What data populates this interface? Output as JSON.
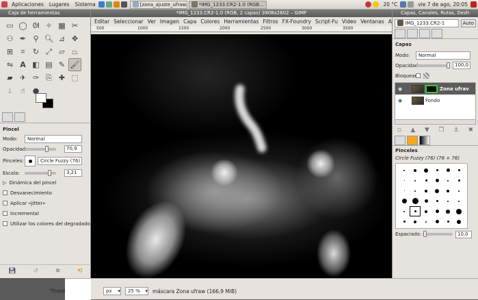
{
  "top_panel": {
    "menus": [
      "Aplicaciones",
      "Lugares",
      "Sistema"
    ],
    "tasks": [
      {
        "label": "",
        "icon": "desktop-icon"
      },
      {
        "label": "[zona_ajuste_ufraw.sc...",
        "icon": "image-icon"
      },
      {
        "label": "*IMG_1233.CR2-1.0 (RGB...",
        "icon": "gimp-icon"
      }
    ],
    "weather": "20 °C",
    "clock": "vie  7 de ago, 20:05"
  },
  "toolbox": {
    "title": "Caja de herramientas",
    "tool_options_title": "Pincel",
    "mode_label": "Modo:",
    "mode_value": "Normal",
    "opacity_label": "Opacidad:",
    "opacity_value": "70,9",
    "opacity_level": 0.709,
    "brush_label": "Pinceles:",
    "brush_value": "Circle Fuzzy (76)",
    "scale_label": "Escala:",
    "scale_value": "3,21",
    "scale_level": 0.8,
    "dynamics_label": "Dinámica del pincel",
    "checks": [
      "Desvanecimiento",
      "Aplicar «jitter»",
      "Incremental",
      "Utilizar los colores del degradado"
    ]
  },
  "image_window": {
    "title": "*IMG_1233.CR2-1.0 (RGB, 2 capas) 3908x2602 – GIMP",
    "menus": [
      "Editar",
      "Seleccionar",
      "Ver",
      "Imagen",
      "Capa",
      "Colores",
      "Herramientas",
      "Filtros",
      "FX-Foundry",
      "Script-Fu",
      "Video",
      "Ventanas",
      "Ayuda"
    ],
    "ruler_ticks": [
      "500",
      "1000",
      "1500",
      "2000",
      "2500",
      "3000",
      "3500"
    ],
    "unit": "px",
    "zoom": "25 %",
    "status_text": "máscara Zona ufraw (166,9 MiB)",
    "behind_label": "Thund"
  },
  "dock": {
    "title": "Capas, Canales, Rutas, Desh",
    "image_select": "IMG_1233.CR2-1",
    "auto_label": "Auto",
    "layers_header": "Capas",
    "mode_label": "Modo:",
    "mode_value": "Normal",
    "opacity_label": "Opacidad:",
    "opacity_value": "100,0",
    "lock_label": "Bloquear:",
    "layers": [
      {
        "name": "Zona ufrav",
        "selected": true
      },
      {
        "name": "Fondo",
        "selected": false
      }
    ],
    "brushes_header": "Pinceles",
    "brush_name": "Circle Fuzzy (76) (76 × 76)",
    "spacing_label": "Espaciado:",
    "spacing_value": "10,0",
    "spacing_level": 0.1
  },
  "colors": {
    "panel": "#e6e3de",
    "titlebar": "#5b5b5b",
    "selection": "#5c5c5c",
    "mask_border": "#33cc33"
  }
}
